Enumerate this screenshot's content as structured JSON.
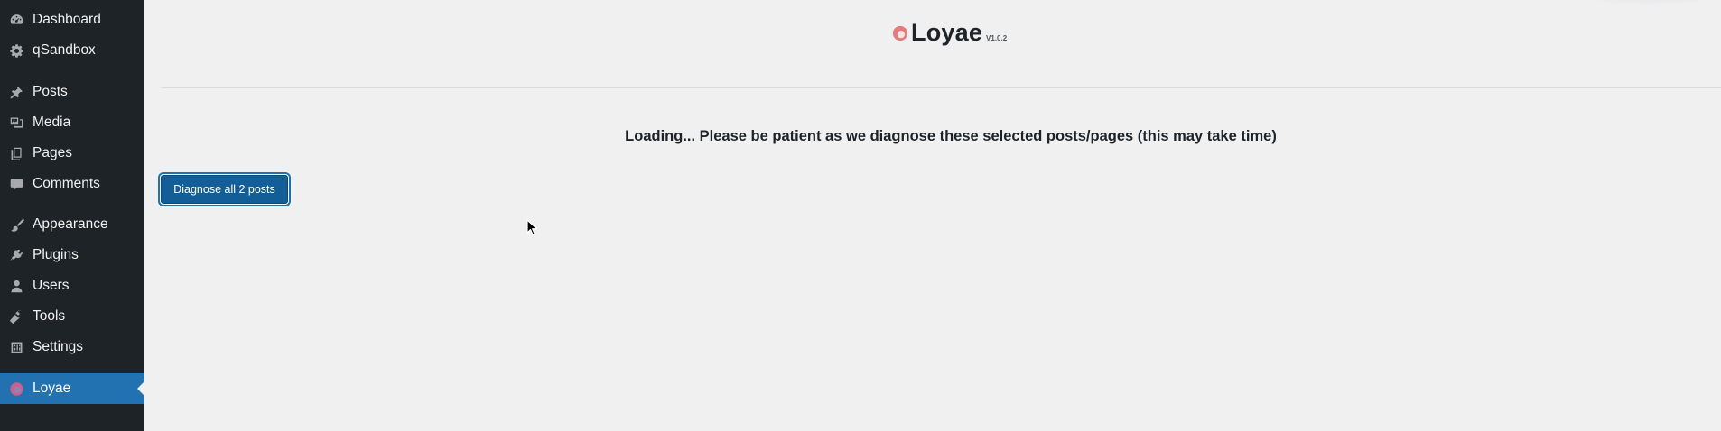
{
  "sidebar": {
    "items": [
      {
        "label": "Dashboard",
        "icon": "dashboard-icon"
      },
      {
        "label": "qSandbox",
        "icon": "gear-icon"
      },
      {
        "label": "Posts",
        "icon": "pin-icon"
      },
      {
        "label": "Media",
        "icon": "media-icon"
      },
      {
        "label": "Pages",
        "icon": "pages-icon"
      },
      {
        "label": "Comments",
        "icon": "comment-icon"
      },
      {
        "label": "Appearance",
        "icon": "brush-icon"
      },
      {
        "label": "Plugins",
        "icon": "plug-icon"
      },
      {
        "label": "Users",
        "icon": "user-icon"
      },
      {
        "label": "Tools",
        "icon": "wrench-icon"
      },
      {
        "label": "Settings",
        "icon": "sliders-icon"
      },
      {
        "label": "Loyae",
        "icon": "loyae-logo-icon",
        "current": true
      }
    ]
  },
  "brand": {
    "name": "Loyae",
    "version": "V1.0.2"
  },
  "main": {
    "loading_message": "Loading... Please be patient as we diagnose these selected posts/pages (this may take time)",
    "diagnose_button_label": "Diagnose all 2 posts"
  },
  "colors": {
    "sidebar_bg": "#1d2327",
    "sidebar_text": "#f0f0f1",
    "accent": "#2271b1",
    "button_bg": "#135e96",
    "page_bg": "#f0f0f1",
    "logo_outer": "#e57b7b"
  }
}
